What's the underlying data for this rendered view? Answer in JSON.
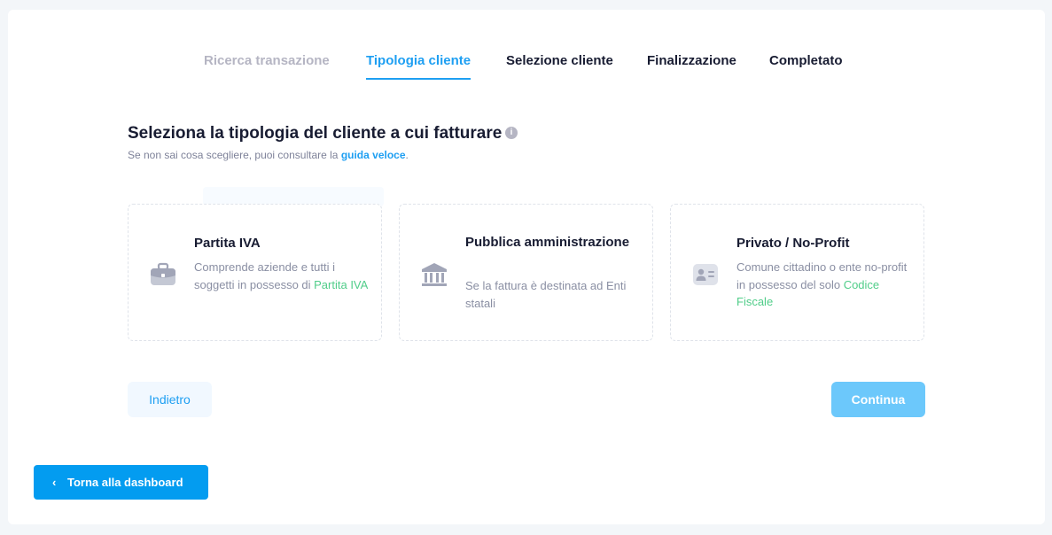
{
  "stepper": {
    "steps": [
      {
        "label": "Ricerca transazione",
        "state": "done"
      },
      {
        "label": "Tipologia cliente",
        "state": "active"
      },
      {
        "label": "Selezione cliente",
        "state": "upcoming"
      },
      {
        "label": "Finalizzazione",
        "state": "upcoming"
      },
      {
        "label": "Completato",
        "state": "upcoming"
      }
    ]
  },
  "header": {
    "title": "Seleziona la tipologia del cliente a cui fatturare",
    "info_icon": "i",
    "subtitle_prefix": "Se non sai cosa scegliere, puoi consultare la ",
    "subtitle_link": "guida veloce",
    "subtitle_suffix": "."
  },
  "options": [
    {
      "icon": "briefcase-icon",
      "title": "Partita IVA",
      "desc_before": "Comprende aziende e tutti i soggetti in possesso di ",
      "desc_highlight": "Partita IVA"
    },
    {
      "icon": "bank-icon",
      "title": "Pubblica amministrazione",
      "desc_before": "Se la fattura è destinata ad Enti statali",
      "desc_highlight": ""
    },
    {
      "icon": "id-card-icon",
      "title": "Privato / No-Profit",
      "desc_before": "Comune cittadino o ente no-profit in possesso del solo ",
      "desc_highlight": "Codice Fiscale"
    }
  ],
  "actions": {
    "back_label": "Indietro",
    "continue_label": "Continua",
    "dashboard_label": "Torna alla dashboard",
    "dashboard_chevron": "‹"
  },
  "colors": {
    "accent": "#1e9ff2",
    "highlight": "#50cd89",
    "primary_button": "#039cf0",
    "continue_button": "#6cc8fb"
  }
}
